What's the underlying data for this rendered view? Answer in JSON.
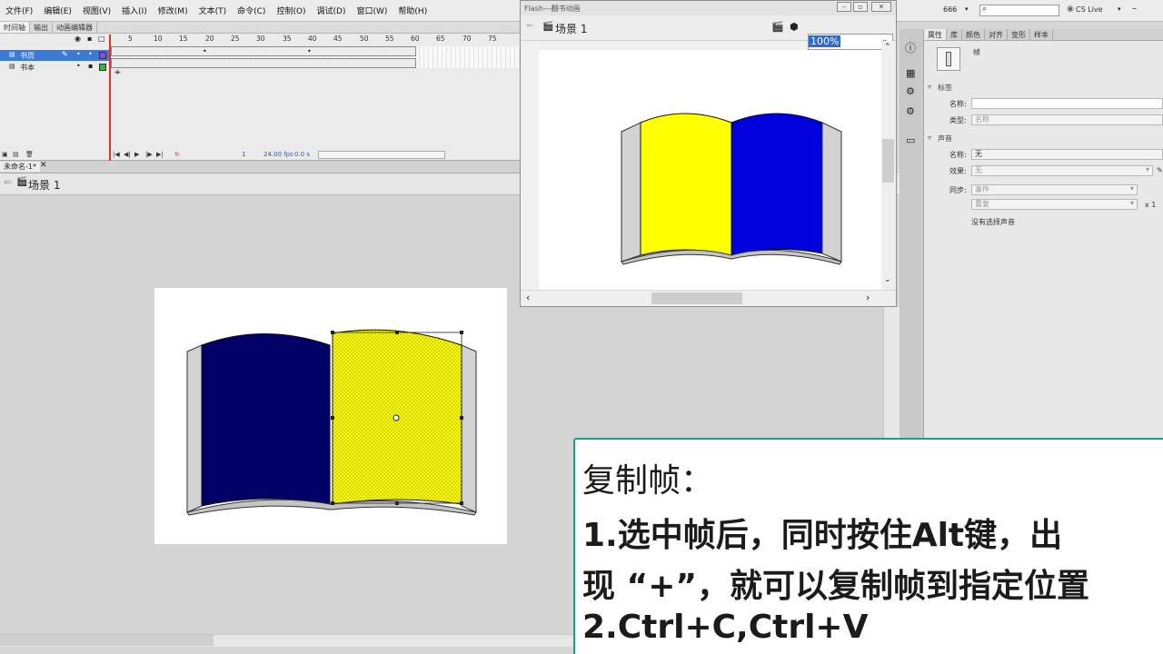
{
  "menu": {
    "items": [
      "文件(F)",
      "编辑(E)",
      "视图(V)",
      "插入(I)",
      "修改(M)",
      "文本(T)",
      "命令(C)",
      "控制(O)",
      "调试(D)",
      "窗口(W)",
      "帮助(H)"
    ]
  },
  "topright": {
    "workspace": "666",
    "search_placeholder": "",
    "cslive": "CS Live"
  },
  "timeline": {
    "tabs": [
      "时间轴",
      "输出",
      "动画编辑器"
    ],
    "layers": [
      {
        "name": "书页",
        "selected": true,
        "color": "#8a4bd6"
      },
      {
        "name": "书本",
        "selected": false,
        "color": "#2fb83f"
      }
    ],
    "ruler": [
      "5",
      "10",
      "15",
      "20",
      "25",
      "30",
      "35",
      "40",
      "45",
      "50",
      "55",
      "60",
      "65",
      "70",
      "75"
    ],
    "status": {
      "frame": "1",
      "fps": "24.00 fps",
      "time": "0.0 s"
    }
  },
  "document": {
    "tab": "未命名-1*",
    "scene": "场景 1"
  },
  "flash_window": {
    "title": "Flash---翻书动画",
    "scene": "场景 1",
    "zoom": "100%"
  },
  "properties": {
    "tabs": [
      "属性",
      "库",
      "颜色",
      "对齐",
      "变形",
      "样本"
    ],
    "object_type": "帧",
    "sections": {
      "label": "标签",
      "sound": "声音"
    },
    "fields": {
      "name_label": "名称:",
      "type_label": "类型:",
      "type_value": "名称",
      "sound_name_label": "名称:",
      "sound_name_value": "无",
      "effect_label": "效果:",
      "effect_value": "无",
      "sync_label": "同步:",
      "sync_value": "事件",
      "repeat_value": "重复",
      "repeat_count": "x 1",
      "no_sound": "没有选择声音"
    }
  },
  "caption": {
    "line1": "复制帧：",
    "line2": "1.选中帧后，同时按住Alt键，出",
    "line3": "现 “+”，就可以复制帧到指定位置",
    "line4": "2.Ctrl+C,Ctrl+V"
  },
  "colors": {
    "accent": "#2f6ad0",
    "caption_border": "#16a08c",
    "book_yellow": "#ffff00",
    "book_blue": "#0000dd",
    "book_navy": "#000066"
  }
}
